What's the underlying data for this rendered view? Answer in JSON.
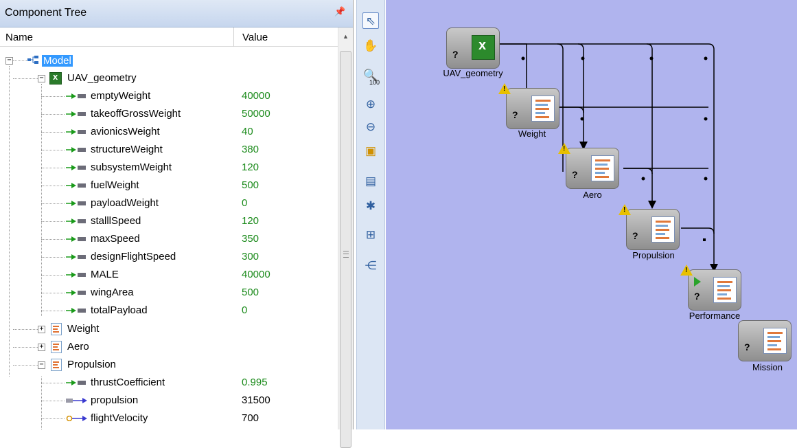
{
  "panel": {
    "title": "Component Tree",
    "pin_icon": "pin-icon",
    "columns": {
      "name": "Name",
      "value": "Value"
    }
  },
  "tree": {
    "root": "Model",
    "uav_geometry": {
      "label": "UAV_geometry",
      "params": [
        {
          "name": "emptyWeight",
          "value": "40000"
        },
        {
          "name": "takeoffGrossWeight",
          "value": "50000"
        },
        {
          "name": "avionicsWeight",
          "value": "40"
        },
        {
          "name": "structureWeight",
          "value": "380"
        },
        {
          "name": "subsystemWeight",
          "value": "120"
        },
        {
          "name": "fuelWeight",
          "value": "500"
        },
        {
          "name": "payloadWeight",
          "value": "0"
        },
        {
          "name": "stalllSpeed",
          "value": "120"
        },
        {
          "name": "maxSpeed",
          "value": "350"
        },
        {
          "name": "designFlightSpeed",
          "value": "300"
        },
        {
          "name": "MALE",
          "value": "40000"
        },
        {
          "name": "wingArea",
          "value": "500"
        },
        {
          "name": "totalPayload",
          "value": "0"
        }
      ]
    },
    "weight": {
      "label": "Weight"
    },
    "aero": {
      "label": "Aero"
    },
    "propulsion": {
      "label": "Propulsion",
      "params": [
        {
          "name": "thrustCoefficient",
          "value": "0.995"
        },
        {
          "name": "propulsion",
          "value": "31500"
        },
        {
          "name": "flightVelocity",
          "value": "700"
        }
      ]
    }
  },
  "canvas": {
    "nodes": {
      "uav_geometry": "UAV_geometry",
      "weight": "Weight",
      "aero": "Aero",
      "propulsion": "Propulsion",
      "performance": "Performance",
      "mission": "Mission"
    }
  },
  "toolbar": {
    "icons": [
      "select-pointer-icon",
      "pan-hand-icon",
      "zoom-100-icon",
      "zoom-in-icon",
      "zoom-out-icon",
      "zoom-fit-icon",
      "properties-icon",
      "find-icon",
      "add-component-icon",
      "tree-layout-icon"
    ],
    "zoom_label": "100"
  },
  "colors": {
    "canvas_bg": "#b0b4ee",
    "value_green": "#1a8a1a",
    "selection": "#3399ff"
  }
}
